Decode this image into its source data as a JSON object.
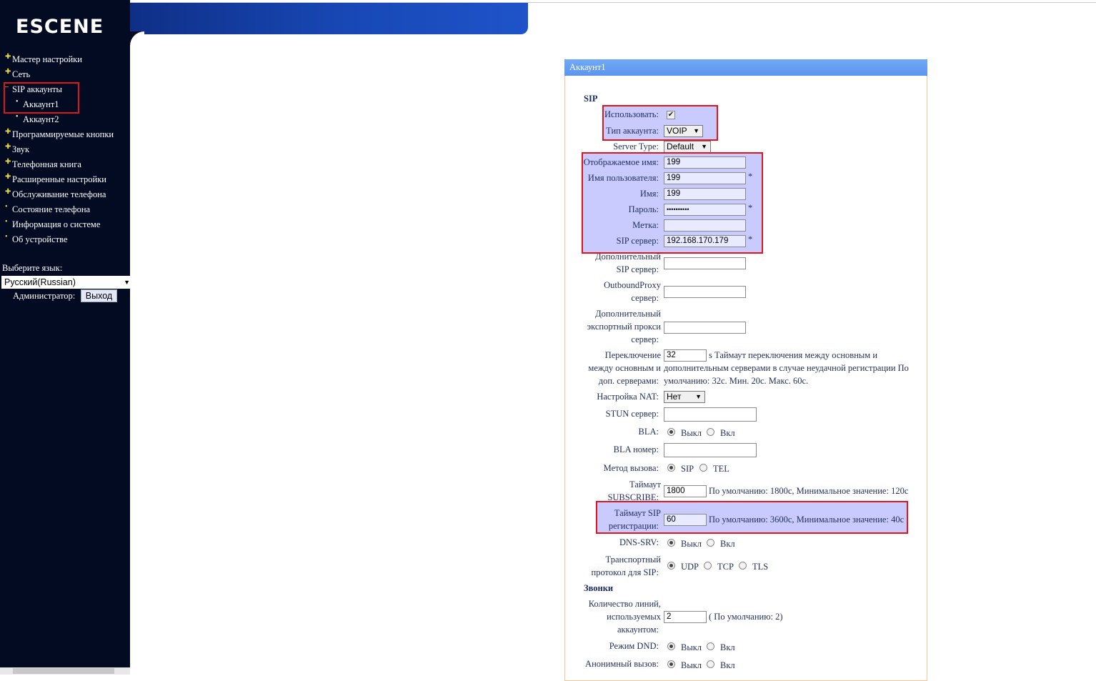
{
  "brand": {
    "logo_text": "ESCENE"
  },
  "sidebar": {
    "items": [
      {
        "label": "Мастер настройки",
        "sub": false
      },
      {
        "label": "Сеть",
        "sub": false
      },
      {
        "label": "SIP аккаунты",
        "sub": false,
        "expanded": true
      },
      {
        "label": "Аккаунт1",
        "sub": true,
        "selected": true
      },
      {
        "label": "Аккаунт2",
        "sub": true
      },
      {
        "label": "Программируемые кнопки",
        "sub": false
      },
      {
        "label": "Звук",
        "sub": false
      },
      {
        "label": "Телефонная книга",
        "sub": false
      },
      {
        "label": "Расширенные настройки",
        "sub": false
      },
      {
        "label": "Обслуживание телефона",
        "sub": false
      },
      {
        "label": "Состояние телефона",
        "sub": false
      },
      {
        "label": "Информация о системе",
        "sub": false
      },
      {
        "label": "Об устройстве",
        "sub": false
      }
    ],
    "lang_label": "Выберите язык:",
    "lang_value": "Русский(Russian)",
    "admin_label": "Администратор:",
    "logout_label": "Выход"
  },
  "panel": {
    "title": "Аккаунт1",
    "section_sip": "SIP",
    "section_calls": "Звонки",
    "enable_label": "Использовать:",
    "enable_checked": true,
    "account_type_label": "Тип аккаунта:",
    "account_type_value": "VOIP",
    "server_type_label": "Server Type:",
    "server_type_value": "Default",
    "display_name_label": "Отображаемое имя:",
    "display_name_value": "199",
    "username_label": "Имя пользователя:",
    "username_value": "199",
    "name_label": "Имя:",
    "name_value": "199",
    "password_label": "Пароль:",
    "password_value": "••••••••••",
    "tag_label": "Метка:",
    "tag_value": "",
    "sip_server_label": "SIP сервер:",
    "sip_server_value": "192.168.170.179",
    "required_mark": "*",
    "backup_sip_label_1": "Дополнительный",
    "backup_sip_label_2": "SIP сервер:",
    "outbound_label_1": "OutboundProxy",
    "outbound_label_2": "сервер:",
    "backup_outbound_label_1": "Дополнительный",
    "backup_outbound_label_2": "экспортный прокси",
    "backup_outbound_label_3": "сервер:",
    "switch_label_1": "Переключение",
    "switch_label_2": "между основным и",
    "switch_label_3": "доп. серверами:",
    "switch_value": "32",
    "switch_hint_1": "s Таймаут переключения между основным и",
    "switch_hint_2": "дополнительным серверами в случае неудачной регистрации По",
    "switch_hint_3": "умолчанию: 32с. Мин. 20с. Макс. 60с.",
    "nat_label": "Настройка NAT:",
    "nat_value": "Нет",
    "stun_label": "STUN сервер:",
    "bla_label": "BLA:",
    "off": "Выкл",
    "on": "Вкл",
    "bla_number_label": "BLA номер:",
    "call_method_label": "Метод вызова:",
    "call_method_sip": "SIP",
    "call_method_tel": "TEL",
    "subscribe_label_1": "Таймаут",
    "subscribe_label_2": "SUBSCRIBE:",
    "subscribe_value": "1800",
    "subscribe_hint": "По умолчанию: 1800с, Минимальное значение: 120с",
    "reg_label_1": "Таймаут SIP",
    "reg_label_2": "регистрации:",
    "reg_value": "60",
    "reg_hint": "По умолчанию: 3600с, Минимальное значение: 40с",
    "dns_label": "DNS-SRV:",
    "transport_label_1": "Транспортный",
    "transport_label_2": "протокол для SIP:",
    "transport_udp": "UDP",
    "transport_tcp": "TCP",
    "transport_tls": "TLS",
    "lines_label_1": "Количество линий,",
    "lines_label_2": "используемых",
    "lines_label_3": "аккаунтом:",
    "lines_value": "2",
    "lines_hint": "( По умолчанию: 2)",
    "dnd_label": "Режим DND:",
    "anon_label": "Анонимный вызов:"
  }
}
